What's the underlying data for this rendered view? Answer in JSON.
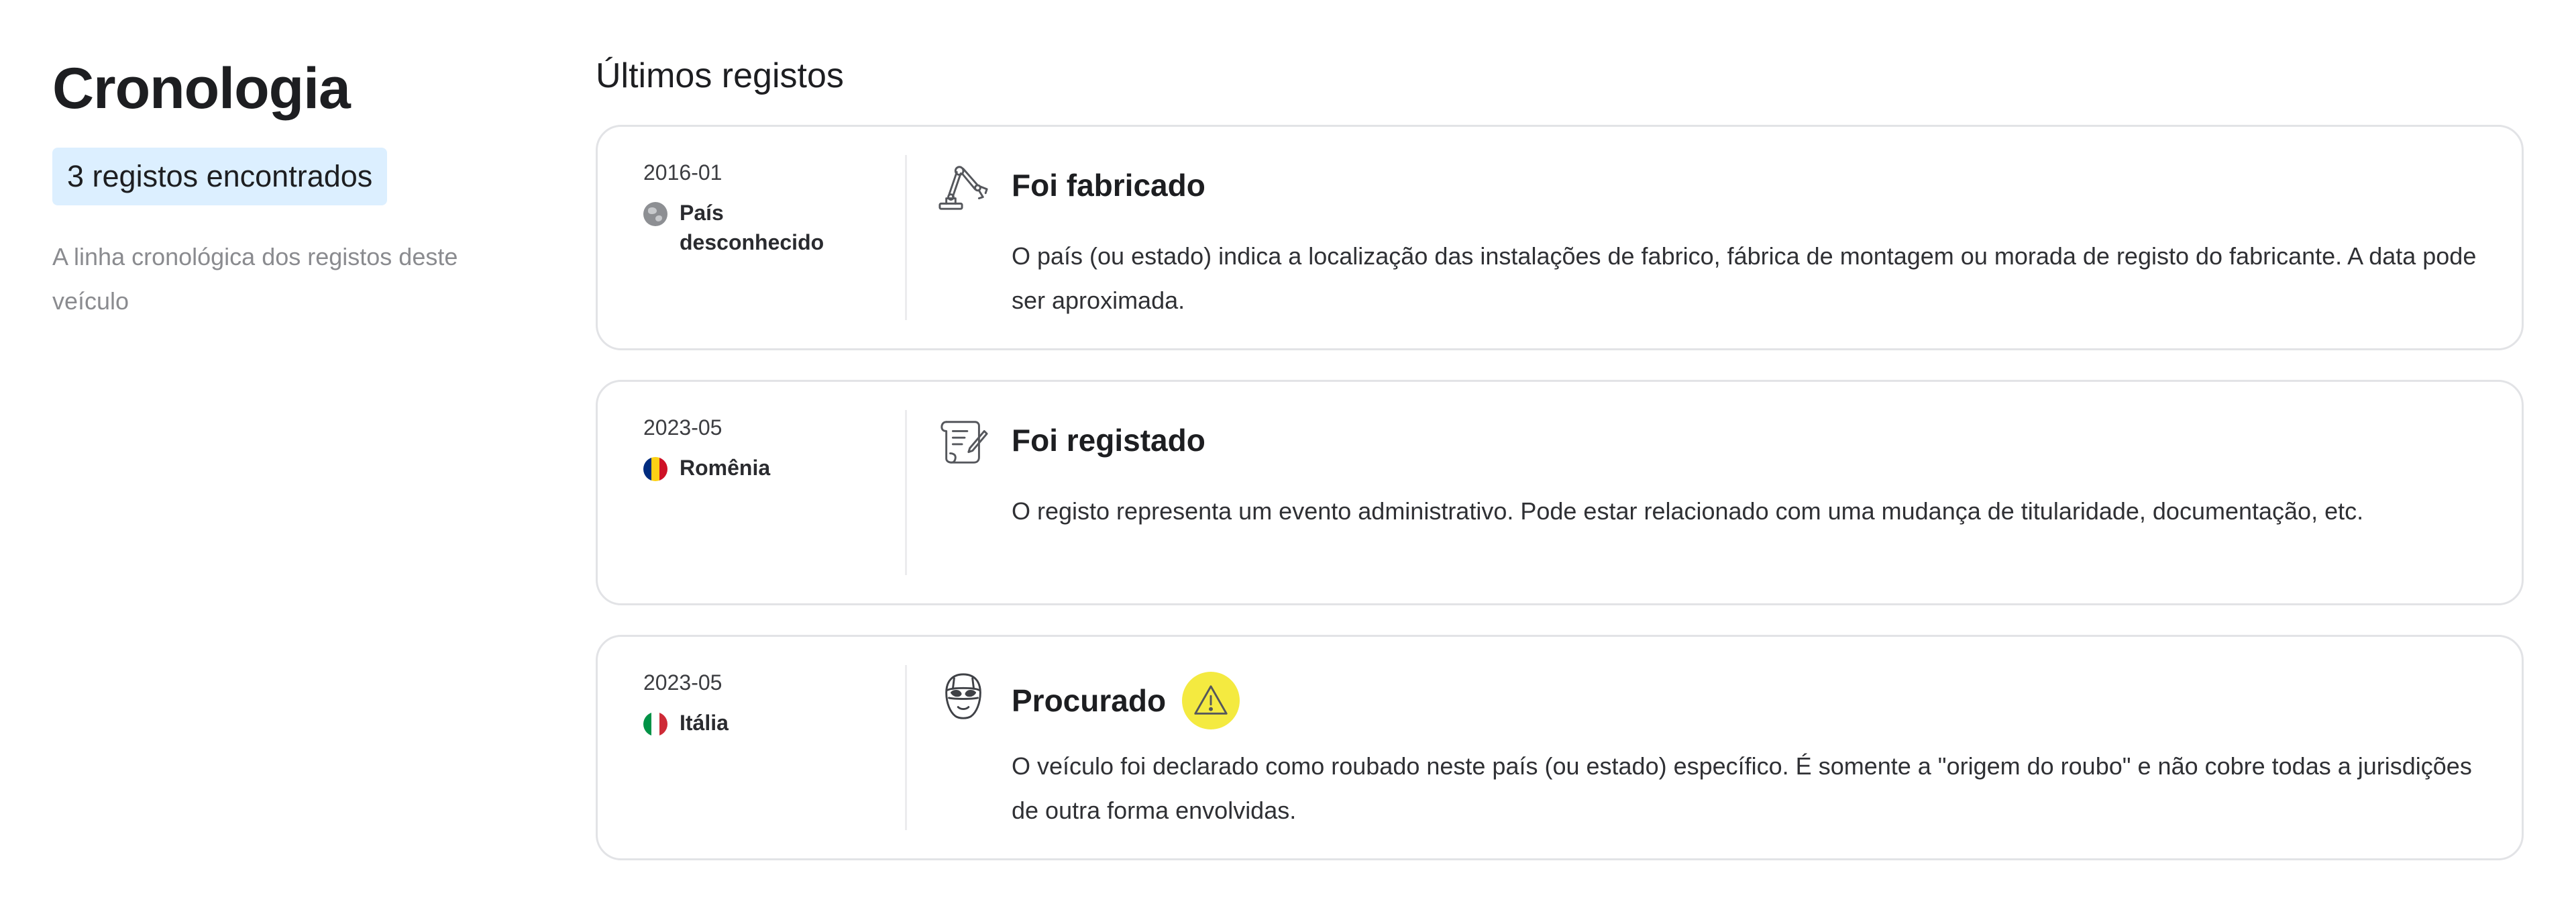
{
  "sidebar": {
    "title": "Cronologia",
    "count_badge": "3 registos encontrados",
    "description": "A linha cronológica dos registos deste veículo"
  },
  "main": {
    "section_title": "Últimos registos",
    "records": [
      {
        "date": "2016-01",
        "country": "País desconhecido",
        "flag_icon": "globe-icon",
        "icon": "robot-arm-icon",
        "title": "Foi fabricado",
        "description": "O país (ou estado) indica a localização das instalações de fabrico, fábrica de montagem ou morada de registo do fabricante. A data pode ser aproximada.",
        "warning": false
      },
      {
        "date": "2023-05",
        "country": "Romênia",
        "flag_colors": [
          "#002B7F",
          "#FCD116",
          "#CE1126"
        ],
        "icon": "scroll-document-icon",
        "title": "Foi registado",
        "description": "O registo representa um evento administrativo. Pode estar relacionado com uma mudança de titularidade, documentação, etc.",
        "warning": false
      },
      {
        "date": "2023-05",
        "country": "Itália",
        "flag_colors": [
          "#009246",
          "#FFFFFF",
          "#CE2B37"
        ],
        "icon": "thief-mask-icon",
        "title": "Procurado",
        "description": "O veículo foi declarado como roubado neste país (ou estado) específico. É somente a \"origem do roubo\" e não cobre todas a jurisdições de outra forma envolvidas.",
        "warning": true,
        "warning_color": "#F4EA40"
      }
    ]
  }
}
